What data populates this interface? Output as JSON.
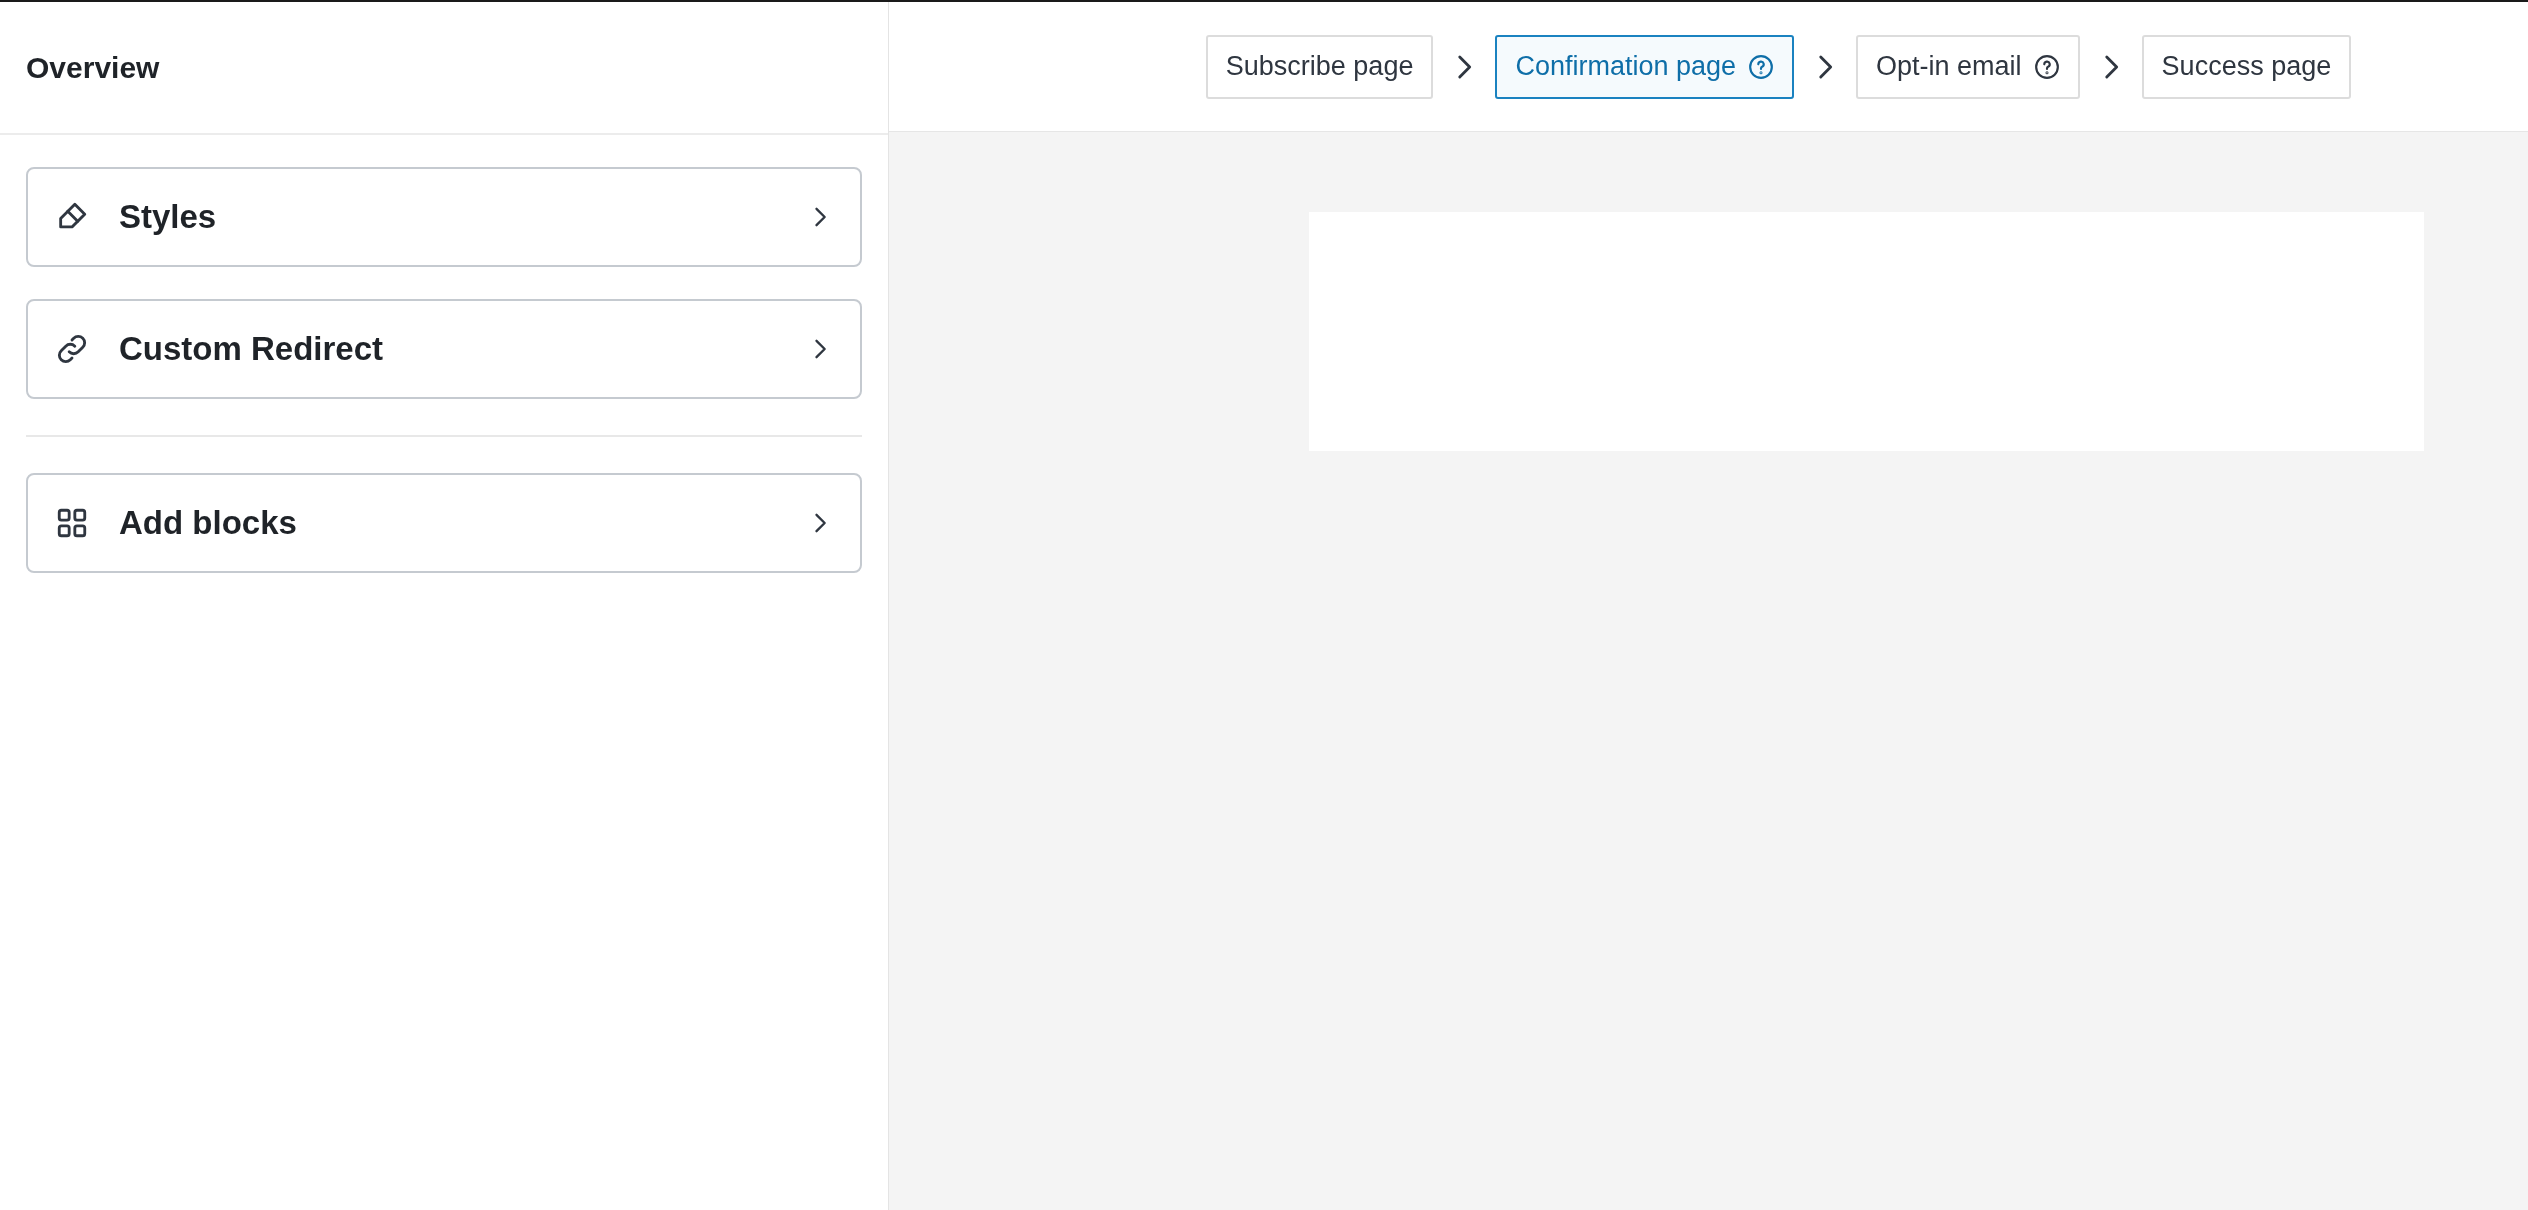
{
  "sidebar": {
    "title": "Overview",
    "items": [
      {
        "kind": "styles",
        "label": "Styles"
      },
      {
        "kind": "redirect",
        "label": "Custom Redirect"
      },
      {
        "kind": "divider"
      },
      {
        "kind": "blocks",
        "label": "Add blocks"
      }
    ]
  },
  "steps": [
    {
      "label": "Subscribe page",
      "selected": false,
      "help": false
    },
    {
      "label": "Confirmation page",
      "selected": true,
      "help": true
    },
    {
      "label": "Opt-in email",
      "selected": false,
      "help": true
    },
    {
      "label": "Success page",
      "selected": false,
      "help": false
    }
  ]
}
